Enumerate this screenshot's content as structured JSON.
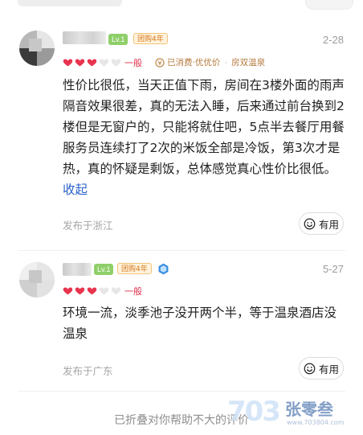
{
  "reviews": [
    {
      "level": "Lv.1",
      "tag": "团购4年",
      "date": "2-28",
      "rating_word": "一般",
      "consume_text": "已消费·优优价",
      "room": "房双温泉",
      "text": "性价比很低，当天正值下雨，房间在3楼外面的雨声隔音效果很差，真的无法入睡，后来通过前台换到2楼但是无窗户的，只能将就住吧，5点半去餐厅用餐服务员连续打了2次的米饭全部是冷饭，第3次才是热，真的怀疑是剩饭，总体感觉真心性价比很低。",
      "collapse": "收起",
      "location": "发布于浙江",
      "useful": "有用",
      "rating_hearts": 3
    },
    {
      "level": "Lv.1",
      "tag": "团购4年",
      "date": "5-27",
      "rating_word": "一般",
      "text": "环境一流，淡季池子没开两个半，等于温泉酒店没温泉",
      "location": "发布于广东",
      "useful": "有用",
      "rating_hearts": 3
    }
  ],
  "folded_text": "已折叠对你帮助不大的评价",
  "watermark": {
    "digits": "703",
    "brand": "张零叁",
    "url": "www.703804.com"
  },
  "colors": {
    "heart_on": "#e8344e",
    "heart_off": "#e6e6e6",
    "link": "#2a62c9",
    "level_badge": "#8fcf6a"
  },
  "icons": [
    "heart-icon",
    "coin-icon",
    "smile-icon",
    "vip-badge-icon"
  ]
}
